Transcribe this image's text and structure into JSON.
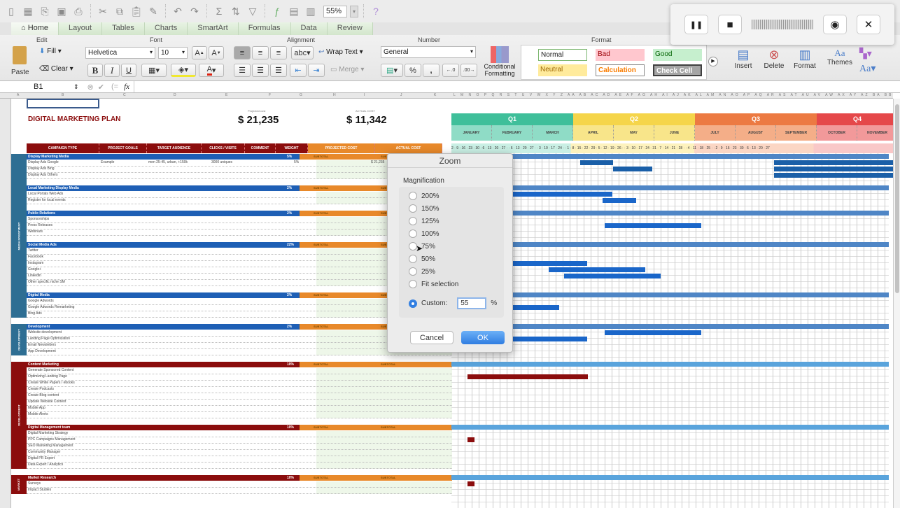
{
  "toolbar": {
    "zoom_value": "55%",
    "icons": [
      "new-icon",
      "templates-icon",
      "open-icon",
      "save-icon",
      "print-icon",
      "cut-icon",
      "copy-icon",
      "paste-icon",
      "format-painter-icon",
      "undo-icon",
      "redo-icon",
      "autosum-icon",
      "sort-icon",
      "filter-icon",
      "formula-builder-icon",
      "show-hide-icon",
      "gallery-icon",
      "help-icon"
    ]
  },
  "tabs": [
    {
      "label": "Home",
      "active": true
    },
    {
      "label": "Layout"
    },
    {
      "label": "Tables"
    },
    {
      "label": "Charts"
    },
    {
      "label": "SmartArt"
    },
    {
      "label": "Formulas"
    },
    {
      "label": "Data"
    },
    {
      "label": "Review"
    }
  ],
  "ribbon": {
    "groups": {
      "edit": "Edit",
      "font": "Font",
      "alignment": "Alignment",
      "number": "Number",
      "format": "Format"
    },
    "paste": "Paste",
    "fill": "Fill",
    "clear": "Clear",
    "font_name": "Helvetica",
    "font_size": "10",
    "bold": "B",
    "italic": "I",
    "underline": "U",
    "wrap_text": "Wrap Text",
    "merge": "Merge",
    "abc": "abc",
    "number_format": "General",
    "percent": "%",
    "comma": ",",
    "conditional_formatting": "Conditional Formatting",
    "styles": [
      {
        "label": "Normal",
        "bg": "#ffffff",
        "fg": "#000000",
        "border": "#7bb66f"
      },
      {
        "label": "Bad",
        "bg": "#ffc7ce",
        "fg": "#9c0006"
      },
      {
        "label": "Good",
        "bg": "#c6efce",
        "fg": "#006100"
      },
      {
        "label": "Neutral",
        "bg": "#ffeb9c",
        "fg": "#9c6500"
      },
      {
        "label": "Calculation",
        "bg": "#f2f2f2",
        "fg": "#fa7d00",
        "border": "#7f7f7f"
      },
      {
        "label": "Check Cell",
        "bg": "#a5a5a5",
        "fg": "#ffffff",
        "border": "#3f3f3f"
      }
    ],
    "insert": "Insert",
    "delete": "Delete",
    "format": "Format",
    "themes": "Themes",
    "aa": "Aa"
  },
  "recorder": {
    "pause": "❚❚",
    "stop": "■",
    "camera": "◉",
    "close": "✕"
  },
  "formula_bar": {
    "name_box": "B1",
    "fx": "fx",
    "formula": ""
  },
  "sheet": {
    "title": "DIGITAL MARKETING PLAN",
    "projected_label": "Projected cost",
    "projected_value": "$ 21,235",
    "actual_label": "ACTUAL COST",
    "actual_value": "$ 11,342",
    "headers": [
      "CAMPAIGN TYPE",
      "PROJECT GOALS",
      "TARGET AUDIENCE",
      "CLICKS / VISITS",
      "COMMENT",
      "WEIGHT",
      "PROJECTED COST",
      "ACTUAL COST"
    ],
    "side_labels": [
      "MEDIA INVESTMENT",
      "DEVELOPMENT",
      "DEVELOPMENT",
      "MARKET"
    ],
    "subtotal_label": "SUBTOTAL",
    "sections": [
      {
        "name": "Display Marketing Media",
        "weight": "5%",
        "color": "blue",
        "items": [
          {
            "name": "Display Ads Google",
            "goal": "Example",
            "audience": "men 25-45, urban, +150k",
            "clicks": "3000 uniques",
            "weight": "5%",
            "actual": "$ 21,235"
          },
          {
            "name": "Display Ads Bing"
          },
          {
            "name": "Display Ads Others"
          }
        ]
      },
      {
        "name": "Local Marketing Display Media",
        "weight": "2%",
        "color": "blue",
        "items": [
          {
            "name": "Local Portals Web Ads"
          },
          {
            "name": "Register for local events"
          }
        ]
      },
      {
        "name": "Public Relations",
        "weight": "2%",
        "color": "blue",
        "items": [
          {
            "name": "Sponsorships"
          },
          {
            "name": "Press Releases"
          },
          {
            "name": "Webinars"
          }
        ]
      },
      {
        "name": "Social Media Ads",
        "weight": "22%",
        "color": "blue",
        "items": [
          {
            "name": "Twitter"
          },
          {
            "name": "Facebook"
          },
          {
            "name": "Instagram"
          },
          {
            "name": "Google+"
          },
          {
            "name": "LinkedIn"
          },
          {
            "name": "Other specific niche SM"
          }
        ]
      },
      {
        "name": "Digital Media",
        "weight": "2%",
        "color": "blue",
        "items": [
          {
            "name": "Google Adwords"
          },
          {
            "name": "Google Adwords Remarketing"
          },
          {
            "name": "Bing Ads"
          }
        ]
      },
      {
        "name": "Development",
        "weight": "2%",
        "color": "blue",
        "items": [
          {
            "name": "Website development"
          },
          {
            "name": "Landing Page Optimization"
          },
          {
            "name": "Email Newsletters"
          },
          {
            "name": "App Development"
          }
        ]
      },
      {
        "name": "Content Marketing",
        "weight": "10%",
        "color": "red",
        "items": [
          {
            "name": "Generate Sponsored Content"
          },
          {
            "name": "Optimizing Landing Page"
          },
          {
            "name": "Create White Papers / ebooks"
          },
          {
            "name": "Create Podcasts"
          },
          {
            "name": "Create Blog content"
          },
          {
            "name": "Update Website Content"
          },
          {
            "name": "Mobile App"
          },
          {
            "name": "Mobile Alerts"
          }
        ]
      },
      {
        "name": "Digital Management team",
        "weight": "10%",
        "color": "red",
        "items": [
          {
            "name": "Digital Marketing Strategy"
          },
          {
            "name": "PPC Campaigns Management"
          },
          {
            "name": "SEO Marketing Management"
          },
          {
            "name": "Community Manager"
          },
          {
            "name": "Digital PR Expert"
          },
          {
            "name": "Data Expert / Analytics"
          }
        ]
      },
      {
        "name": "Market Research",
        "weight": "10%",
        "color": "red",
        "items": [
          {
            "name": "Surveys"
          },
          {
            "name": "Impact Studies"
          }
        ]
      }
    ],
    "quarters": [
      {
        "label": "Q1",
        "color": "#3fbf9a",
        "months": [
          "JANUARY",
          "FEBRUARY",
          "MARCH"
        ],
        "light": "#8fdcc6"
      },
      {
        "label": "Q2",
        "color": "#f5d54a",
        "months": [
          "APRIL",
          "MAY",
          "JUNE"
        ],
        "light": "#f8e58a"
      },
      {
        "label": "Q3",
        "color": "#ec7a42",
        "months": [
          "JULY",
          "AUGUST",
          "SEPTEMBER"
        ],
        "light": "#f4ae88"
      },
      {
        "label": "Q4",
        "color": "#e5484a",
        "months": [
          "OCTOBER",
          "NOVEMBER"
        ],
        "light": "#f2999a"
      }
    ],
    "week_days": "2 · 9 · 16 · 23 · 30 · 6 · 13 · 20 · 27 · · 6 · 13 · 20 · 27 · · 3 · 10 · 17 · 24 · · 1 · 8 · 15 · 22 · 29 · 5 · 12 · 19 · 26 · · 3 · 10 · 17 · 24 · 31 · 7 · 14 · 21 · 28 · · 4 · 11 · 18 · 25 · · 2 · 9 · 16 · 23 · 30 · 6 · 13 · 20 · 27"
  },
  "dialog": {
    "title": "Zoom",
    "group_label": "Magnification",
    "options": [
      "200%",
      "150%",
      "125%",
      "100%",
      "75%",
      "50%",
      "25%",
      "Fit selection"
    ],
    "custom_label": "Custom:",
    "custom_value": "55",
    "percent": "%",
    "cancel": "Cancel",
    "ok": "OK",
    "selected": "Custom"
  }
}
